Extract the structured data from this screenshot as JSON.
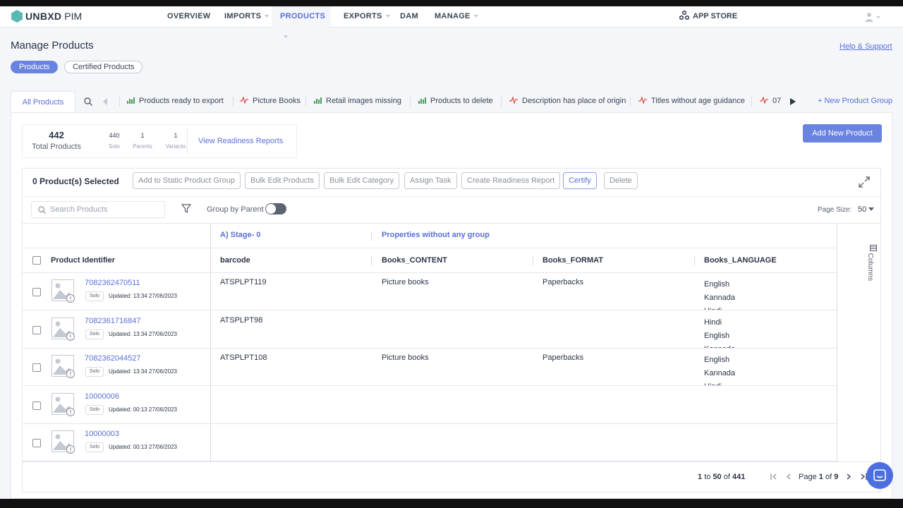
{
  "app": {
    "brand": "UNBXD",
    "brand_sub": "PIM"
  },
  "nav": {
    "items": [
      {
        "label": "OVERVIEW",
        "caret": false
      },
      {
        "label": "IMPORTS",
        "caret": true
      },
      {
        "label": "PRODUCTS",
        "caret": true,
        "active": true
      },
      {
        "label": "EXPORTS",
        "caret": true
      },
      {
        "label": "DAM",
        "caret": false
      },
      {
        "label": "MANAGE",
        "caret": true
      }
    ],
    "app_store": "APP STORE"
  },
  "page": {
    "title": "Manage Products",
    "help_link": "Help & Support",
    "pills": {
      "active": "Products",
      "other": "Certified Products"
    }
  },
  "groups": {
    "all_tab": "All Products",
    "tabs": [
      {
        "label": "Products ready to export",
        "icon": "bar-chart-icon"
      },
      {
        "label": "Picture Books",
        "icon": "pulse-icon"
      },
      {
        "label": "Retail images missing",
        "icon": "bar-chart-icon"
      },
      {
        "label": "Products to delete",
        "icon": "bar-chart-icon"
      },
      {
        "label": "Description has place of origin",
        "icon": "pulse-icon"
      },
      {
        "label": "Titles without age guidance",
        "icon": "pulse-icon"
      },
      {
        "label": "07",
        "icon": "pulse-icon"
      }
    ],
    "new_group": "+ New Product Group"
  },
  "stats": {
    "total": "442",
    "total_label": "Total Products",
    "solo": "440",
    "solo_label": "Solo",
    "parents": "1",
    "parents_label": "Parents",
    "variants": "1",
    "variants_label": "Variants",
    "readiness_link": "View Readiness Reports"
  },
  "add_new_button": "Add New Product",
  "selection": {
    "count_label": "0 Product(s) Selected",
    "actions": [
      "Add to Static Product Group",
      "Bulk Edit Products",
      "Bulk Edit Category",
      "Assign Task",
      "Create Readiness Report",
      "Certify",
      "Delete"
    ]
  },
  "filters": {
    "search_placeholder": "Search Products",
    "group_by_parent": "Group by Parent",
    "group_by_parent_on": false,
    "page_size_label": "Page Size:",
    "page_size": "50"
  },
  "table": {
    "column_groups": [
      "A) Stage- 0",
      "Properties without any group"
    ],
    "id_header": "Product Identifier",
    "headers": [
      "barcode",
      "Books_CONTENT",
      "Books_FORMAT",
      "Books_LANGUAGE"
    ],
    "side_tab": "Columns",
    "rows": [
      {
        "id": "7082362470511",
        "type": "Solo",
        "updated": "Updated: 13:34 27/06/2023",
        "barcode": "ATSPLPT119",
        "content": "Picture books",
        "format": "Paperbacks",
        "languages": [
          "English",
          "Kannada",
          "Hindi"
        ]
      },
      {
        "id": "7082361716847",
        "type": "Solo",
        "updated": "Updated: 13:34 27/06/2023",
        "barcode": "ATSPLPT98",
        "content": "",
        "format": "",
        "languages": [
          "Hindi",
          "English",
          "Kannada"
        ]
      },
      {
        "id": "7082362044527",
        "type": "Solo",
        "updated": "Updated: 13:34 27/06/2023",
        "barcode": "ATSPLPT108",
        "content": "Picture books",
        "format": "Paperbacks",
        "languages": [
          "English",
          "Kannada",
          "Hindi"
        ]
      },
      {
        "id": "10000006",
        "type": "Solo",
        "updated": "Updated: 00:13 27/06/2023",
        "barcode": "",
        "content": "",
        "format": "",
        "languages": []
      },
      {
        "id": "10000003",
        "type": "Solo",
        "updated": "Updated: 00:13 27/06/2023",
        "barcode": "",
        "content": "",
        "format": "",
        "languages": []
      }
    ]
  },
  "pagination": {
    "from": "1",
    "to_word": "to",
    "to": "50",
    "of_word": "of",
    "total": "441",
    "page_word": "Page",
    "page": "1",
    "page_of": "of",
    "pages": "9"
  }
}
